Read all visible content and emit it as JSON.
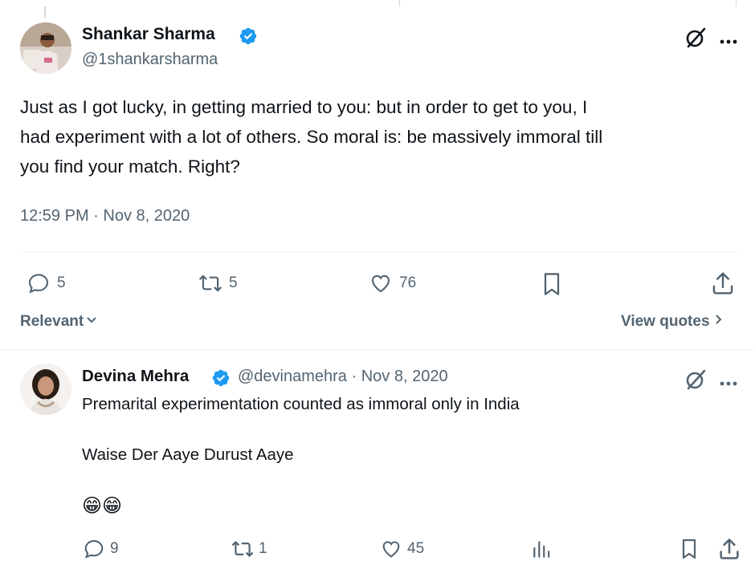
{
  "main_tweet": {
    "author_name": "Shankar Sharma",
    "author_handle": "@1shankarsharma",
    "text_line1": "Just as I got lucky, in getting married to you: but in order to get to you, I",
    "text_line2": "had experiment with a lot of others. So moral is: be massively immoral till",
    "text_line3": "you find your match. Right?",
    "timestamp": "12:59 PM · Nov 8, 2020",
    "replies": "5",
    "reposts": "5",
    "likes": "76"
  },
  "sort_bar": {
    "sort_label": "Relevant",
    "view_quotes": "View quotes"
  },
  "reply_tweet": {
    "author_name": "Devina Mehra",
    "author_handle": "@devinamehra",
    "date": "· Nov 8, 2020",
    "text_line1": "Premarital experimentation counted as immoral only in India",
    "text_line2": "Waise Der Aaye Durust Aaye",
    "emojis": "😁😁",
    "replies": "9",
    "reposts": "1",
    "likes": "45"
  },
  "colors": {
    "verified": "#1d9bf0",
    "secondary_text": "#536471",
    "primary_text": "#0f1419"
  }
}
